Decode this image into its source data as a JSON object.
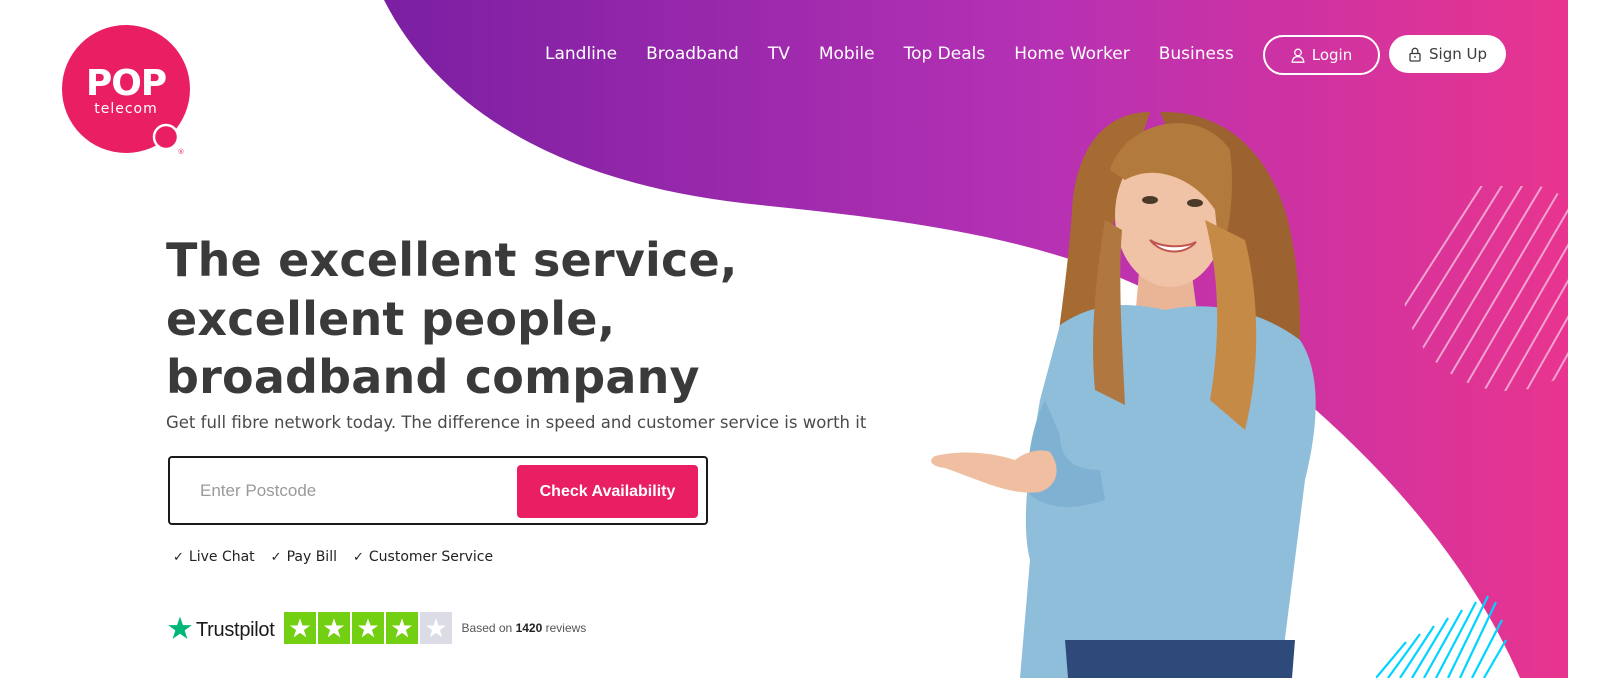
{
  "brand": {
    "logo_word": "POP",
    "logo_sub": "telecom",
    "registered_mark": "®"
  },
  "colors": {
    "accent": "#e91e63",
    "gradient_start": "#7b1fa2",
    "gradient_end": "#e8348f",
    "headline": "#3a3a3a",
    "trustpilot_green": "#73cf11",
    "deco_cyan": "#00d4ff"
  },
  "nav": {
    "items": [
      {
        "label": "Landline"
      },
      {
        "label": "Broadband"
      },
      {
        "label": "TV"
      },
      {
        "label": "Mobile"
      },
      {
        "label": "Top Deals"
      },
      {
        "label": "Home Worker"
      },
      {
        "label": "Business"
      }
    ],
    "login": {
      "label": "Login",
      "icon": "user-icon"
    },
    "signup": {
      "label": "Sign Up",
      "icon": "lock-icon"
    }
  },
  "hero": {
    "headline_lines": [
      "The excellent service,",
      "excellent people,",
      "broadband company"
    ],
    "subhead": "Get full fibre network today. The difference in speed and customer service is worth it",
    "postcode": {
      "placeholder": "Enter Postcode",
      "value": ""
    },
    "check_button": "Check Availability",
    "quick_links": [
      {
        "label": "Live Chat",
        "icon": "check-icon"
      },
      {
        "label": "Pay Bill",
        "icon": "check-icon"
      },
      {
        "label": "Customer Service",
        "icon": "check-icon"
      }
    ],
    "image": "woman-presenting-photo"
  },
  "trustpilot": {
    "name": "Trustpilot",
    "rating_stars": 4,
    "max_stars": 5,
    "based_on": "Based on",
    "review_count": "1420",
    "reviews_word": "reviews"
  }
}
